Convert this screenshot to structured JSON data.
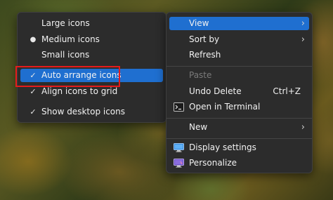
{
  "view_submenu": {
    "items": [
      {
        "label": "Large icons",
        "marker": ""
      },
      {
        "label": "Medium icons",
        "marker": "●"
      },
      {
        "label": "Small icons",
        "marker": ""
      },
      {
        "label": "Auto arrange icons",
        "marker": "✓"
      },
      {
        "label": "Align icons to grid",
        "marker": "✓"
      },
      {
        "label": "Show desktop icons",
        "marker": "✓"
      }
    ]
  },
  "context_menu": {
    "view": "View",
    "sort_by": "Sort by",
    "refresh": "Refresh",
    "paste": "Paste",
    "undo_delete": "Undo Delete",
    "undo_shortcut": "Ctrl+Z",
    "open_in_terminal": "Open in Terminal",
    "new": "New",
    "display_settings": "Display settings",
    "personalize": "Personalize",
    "submenu_arrow": "›"
  },
  "colors": {
    "menu_bg": "#2c2c2c",
    "highlight": "#1f6fd0",
    "annotation_box": "#e51b1b"
  }
}
